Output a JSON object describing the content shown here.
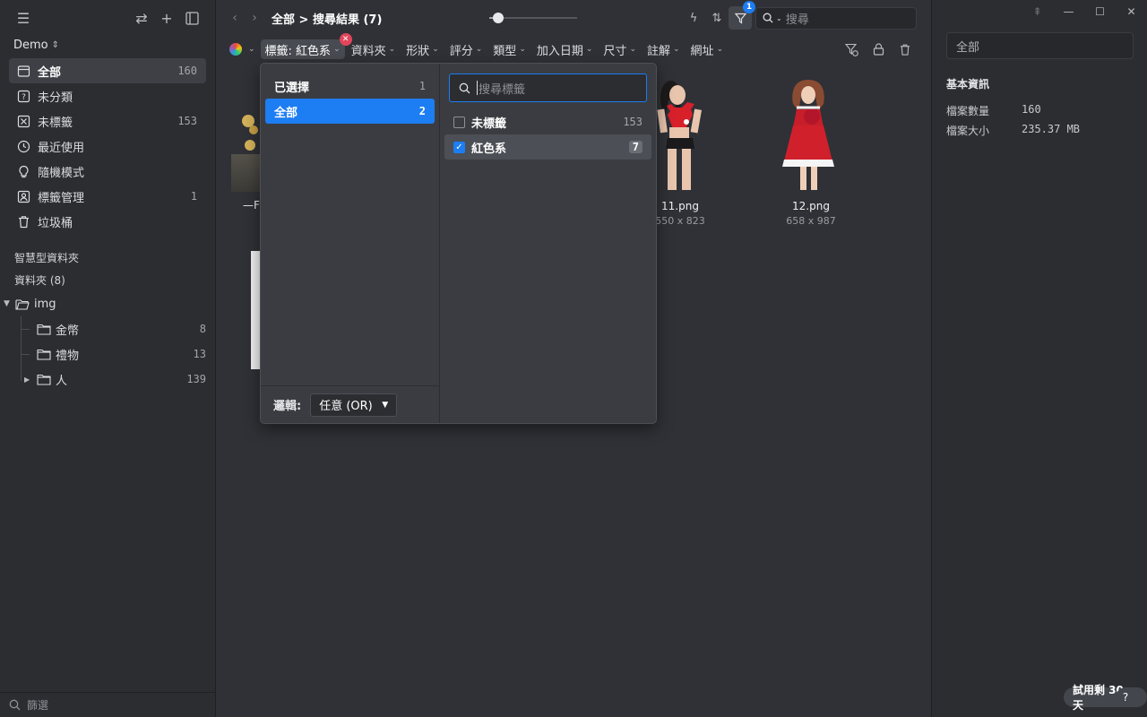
{
  "sidebar": {
    "library": "Demo",
    "nav": [
      {
        "label": "全部",
        "count": "160",
        "icon": "all-items-icon"
      },
      {
        "label": "未分類",
        "count": "",
        "icon": "uncategorized-icon"
      },
      {
        "label": "未標籤",
        "count": "153",
        "icon": "untagged-icon"
      },
      {
        "label": "最近使用",
        "count": "",
        "icon": "recent-icon"
      },
      {
        "label": "隨機模式",
        "count": "",
        "icon": "random-icon"
      },
      {
        "label": "標籤管理",
        "count": "1",
        "icon": "tag-manager-icon"
      },
      {
        "label": "垃圾桶",
        "count": "",
        "icon": "trash-icon"
      }
    ],
    "smart_folders": "智慧型資料夾",
    "folders_title": "資料夾 (8)",
    "tree_root": "img",
    "folders": [
      {
        "label": "金幣",
        "count": "8"
      },
      {
        "label": "禮物",
        "count": "13"
      },
      {
        "label": "人",
        "count": "139"
      }
    ],
    "filter_placeholder": "篩選"
  },
  "topbar": {
    "breadcrumb": "全部 > 搜尋結果 (7)",
    "filter_badge": "1",
    "search_placeholder": "搜尋",
    "thumbnail_size": 0.1
  },
  "filterbar": {
    "chips": [
      "標籤: 紅色系",
      "資料夾",
      "形狀",
      "評分",
      "類型",
      "加入日期",
      "尺寸",
      "註解",
      "網址"
    ]
  },
  "grid": {
    "items": [
      {
        "name": "11.png",
        "dim": "550 x 823"
      },
      {
        "name": "12.png",
        "dim": "658 x 987"
      }
    ],
    "partial_label": "—F"
  },
  "popup": {
    "selected_label": "已選擇",
    "selected_count": "1",
    "all_label": "全部",
    "all_count": "2",
    "logic_label": "邏輯:",
    "logic_value": "任意 (OR)",
    "search_placeholder": "搜尋標籤",
    "tags": [
      {
        "label": "未標籤",
        "count": "153",
        "checked": false
      },
      {
        "label": "紅色系",
        "count": "7",
        "checked": true
      }
    ]
  },
  "inspector": {
    "search_value": "全部",
    "section_title": "基本資訊",
    "rows": [
      {
        "key": "檔案數量",
        "value": "160"
      },
      {
        "key": "檔案大小",
        "value": "235.37 MB"
      }
    ],
    "trial": "試用剩 30 天",
    "help": "?"
  },
  "colors": {
    "accent": "#1d7df2",
    "danger": "#e0455b"
  }
}
